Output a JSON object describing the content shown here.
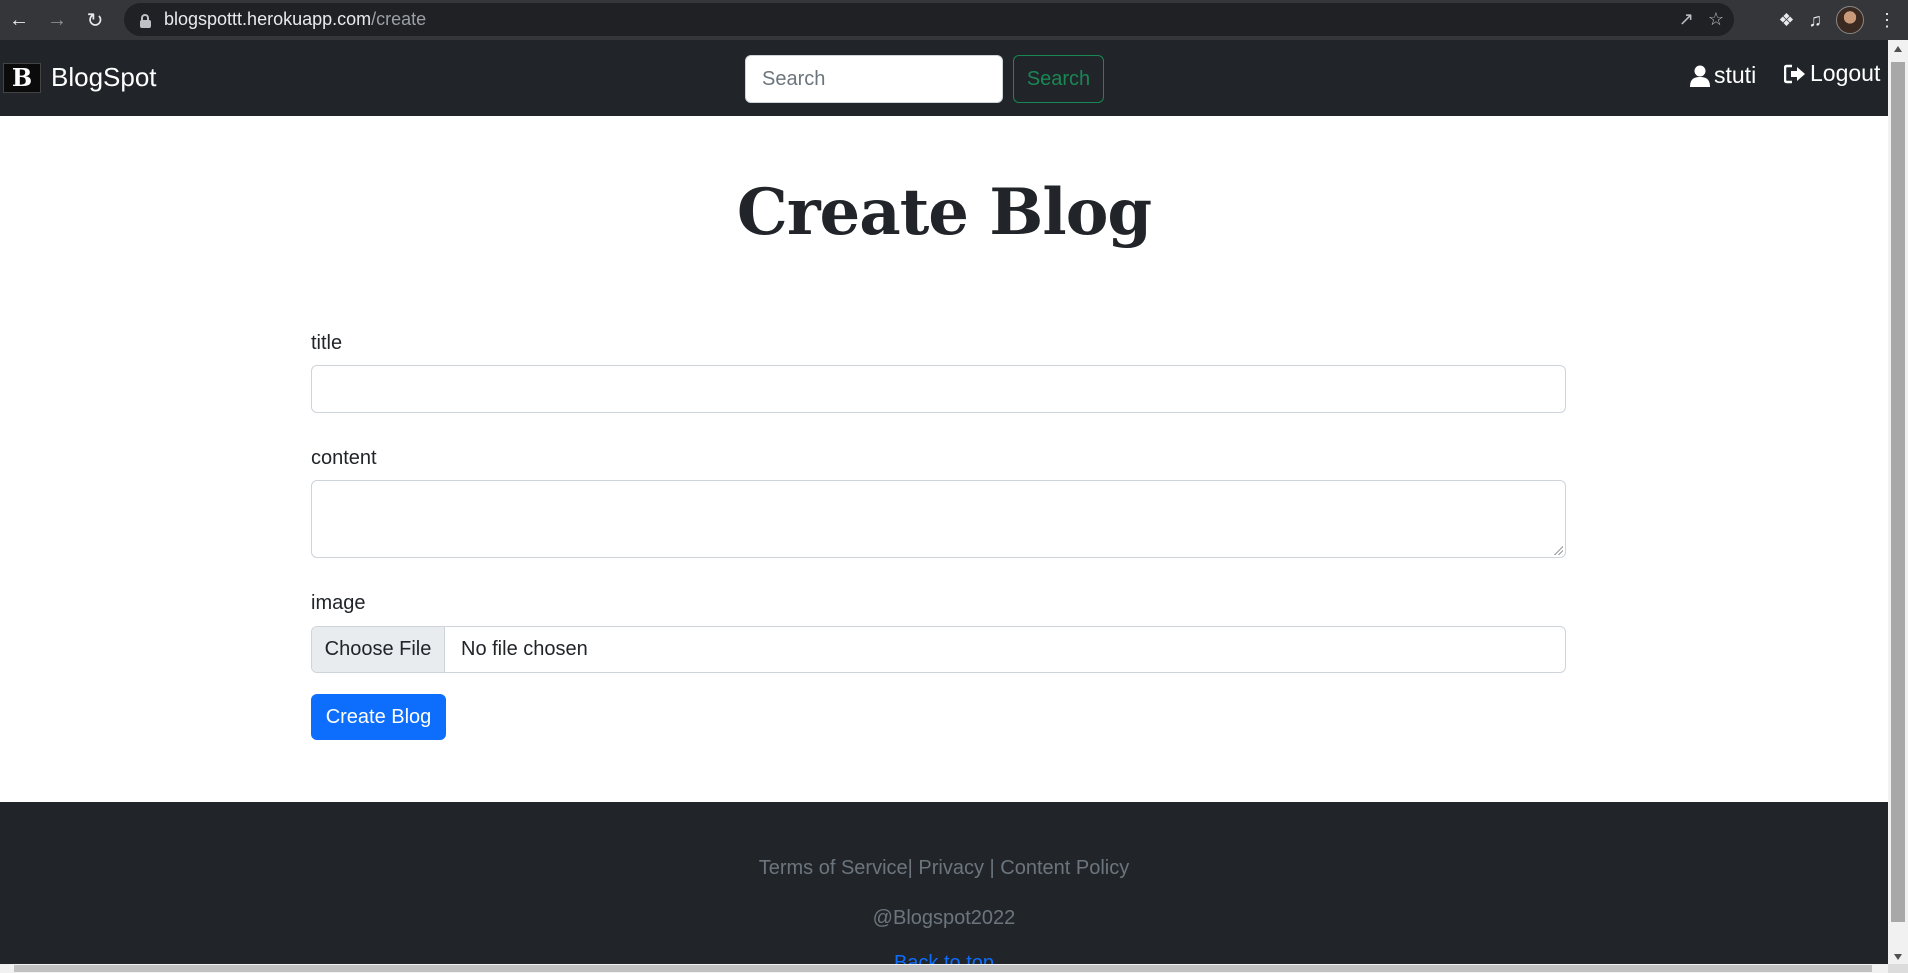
{
  "browser": {
    "url_host": "blogspottt.herokuapp.com",
    "url_path": "/create"
  },
  "navbar": {
    "brand_logo": "B",
    "brand_name": "BlogSpot",
    "search_placeholder": "Search",
    "search_button": "Search",
    "username": "stuti",
    "logout": "Logout"
  },
  "form": {
    "heading": "Create Blog",
    "title_label": "title",
    "title_value": "",
    "content_label": "content",
    "content_value": "",
    "image_label": "image",
    "choose_file": "Choose File",
    "file_status": "No file chosen",
    "submit": "Create Blog"
  },
  "footer": {
    "links": "Terms of Service| Privacy | Content Policy",
    "copyright": "@Blogspot2022",
    "cut_link": "Back to top"
  },
  "colors": {
    "navbar_bg": "#212529",
    "primary": "#0d6efd",
    "success": "#198754",
    "muted": "#6c757d"
  }
}
